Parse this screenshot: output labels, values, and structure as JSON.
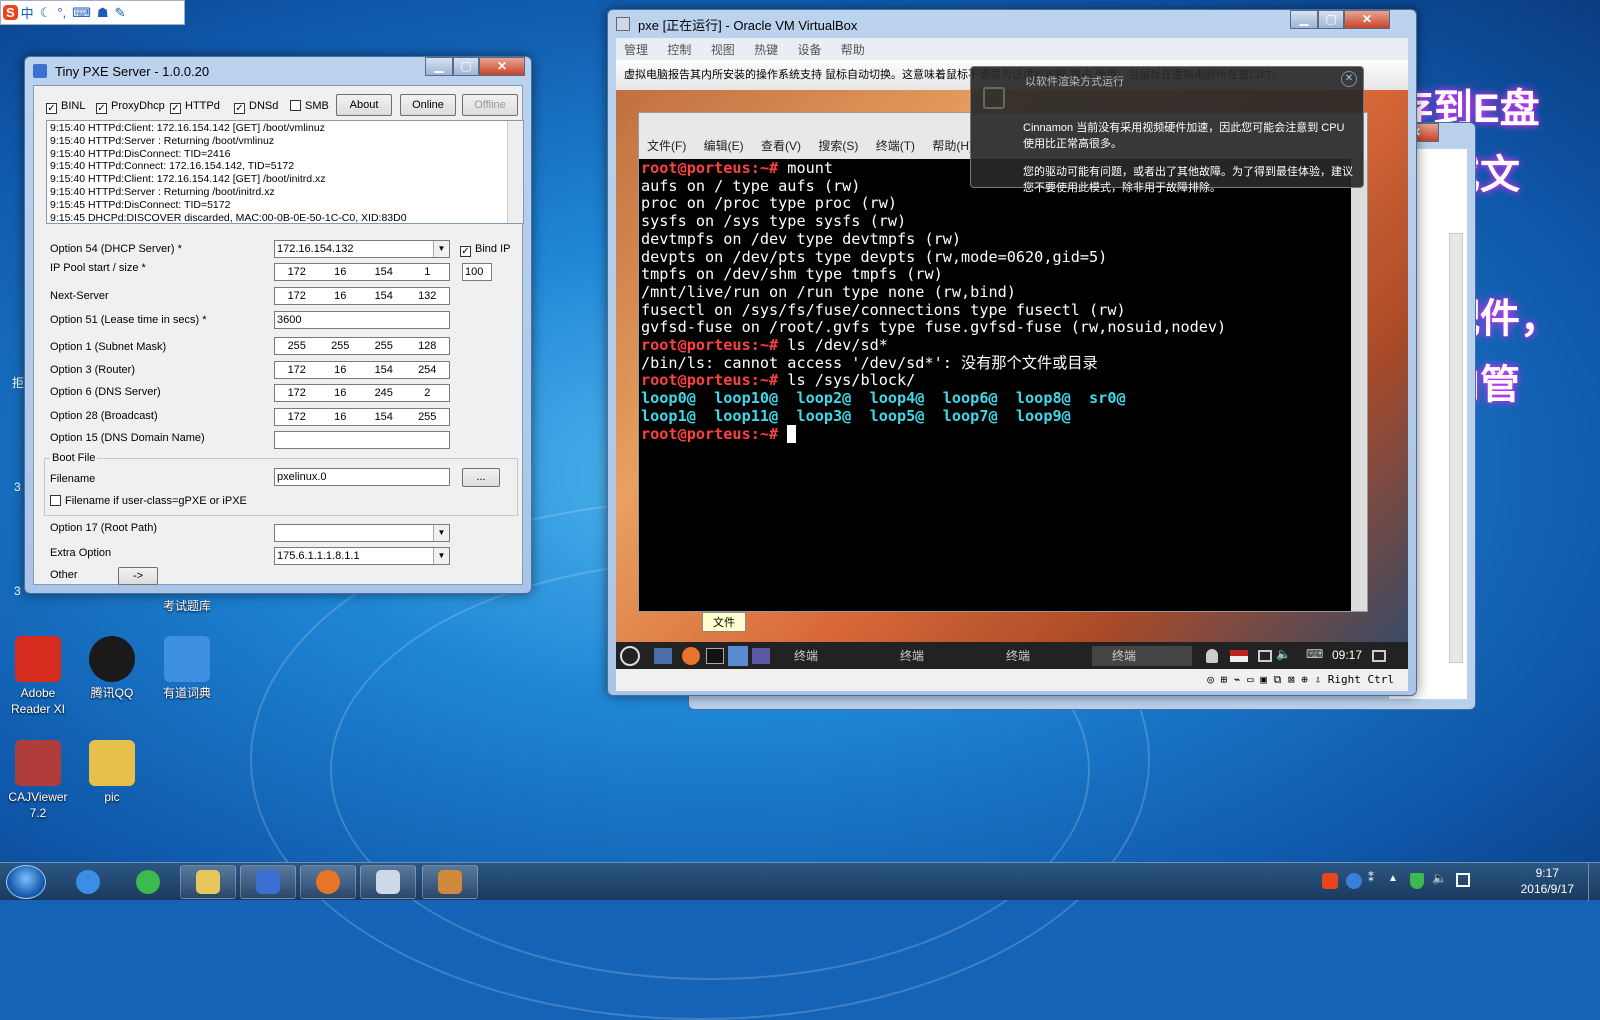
{
  "ime_bar": {
    "logo": "S",
    "lang": "中",
    "items": [
      "moon-icon",
      "punct-icon",
      "keyboard-icon",
      "skin-icon",
      "tools-icon"
    ]
  },
  "desktop": {
    "icons": [
      {
        "label": "Adobe Reader XI",
        "color": "#d62b1f"
      },
      {
        "label": "腾讯QQ",
        "color": "#1a1a1a"
      },
      {
        "label": "有道词典",
        "color": "#3d8fe0"
      },
      {
        "label": "CAJViewer 7.2",
        "color": "#b03c3c"
      },
      {
        "label": "pic",
        "color": "#e6c04a"
      }
    ],
    "bg_texts": [
      "存到E盘",
      "或文",
      "配件，",
      "向管"
    ],
    "partial_label": "考试题库",
    "edge_labels": [
      "拒",
      "3",
      "3"
    ]
  },
  "pxe": {
    "title": "Tiny PXE Server - 1.0.0.20",
    "checkboxes": [
      {
        "label": "BINL",
        "checked": true
      },
      {
        "label": "ProxyDhcp",
        "checked": true
      },
      {
        "label": "HTTPd",
        "checked": true
      },
      {
        "label": "DNSd",
        "checked": true
      },
      {
        "label": "SMB",
        "checked": false
      }
    ],
    "buttons": {
      "about": "About",
      "online": "Online",
      "offline": "Offline"
    },
    "log": [
      "9:15:40 HTTPd:Client: 172.16.154.142 [GET] /boot/vmlinuz",
      "9:15:40 HTTPd:Server : Returning /boot/vmlinuz",
      "9:15:40 HTTPd:DisConnect: TID=2416",
      "9:15:40 HTTPd:Connect: 172.16.154.142, TID=5172",
      "9:15:40 HTTPd:Client: 172.16.154.142 [GET] /boot/initrd.xz",
      "9:15:40 HTTPd:Server : Returning /boot/initrd.xz",
      "9:15:45 HTTPd:DisConnect: TID=5172",
      "9:15:45 DHCPd:DISCOVER discarded, MAC:00-0B-0E-50-1C-C0, XID:83D0"
    ],
    "labels": {
      "opt54": "Option 54 (DHCP Server) *",
      "pool": "IP Pool start / size *",
      "next": "Next-Server",
      "opt51": "Option 51 (Lease time in secs) *",
      "opt1": "Option 1  (Subnet Mask)",
      "opt3": "Option 3  (Router)",
      "opt6": "Option 6  (DNS Server)",
      "opt28": "Option 28 (Broadcast)",
      "opt15": "Option 15 (DNS Domain Name)",
      "bootfile": "Boot File",
      "filename": "Filename",
      "filename_gpxe": "Filename if user-class=gPXE or iPXE",
      "opt17": "Option 17 (Root Path)",
      "extra": "Extra Option",
      "other": "Other",
      "bindip": "Bind IP"
    },
    "values": {
      "opt54": "172.16.154.132",
      "pool": [
        "172",
        "16",
        "154",
        "1"
      ],
      "pool_size": "100",
      "next": [
        "172",
        "16",
        "154",
        "132"
      ],
      "opt51": "3600",
      "opt1": [
        "255",
        "255",
        "255",
        "128"
      ],
      "opt3": [
        "172",
        "16",
        "154",
        "254"
      ],
      "opt6": [
        "172",
        "16",
        "245",
        "2"
      ],
      "opt28": [
        "172",
        "16",
        "154",
        "255"
      ],
      "opt15": "",
      "filename": "pxelinux.0",
      "browse": "...",
      "opt17": "",
      "extra": "175.6.1.1.1.8.1.1",
      "other_btn": "->"
    }
  },
  "vbox": {
    "title": "pxe [正在运行] - Oracle VM VirtualBox",
    "menu": [
      "管理",
      "控制",
      "视图",
      "热键",
      "设备",
      "帮助"
    ],
    "notice": "虚拟电脑报告其内所安装的操作系统支持 鼠标自动切换。这意味着鼠标不需要为该虚拟电脑 独占 使用，当鼠标在虚拟电脑所在窗口时，",
    "host_key": "Right Ctrl"
  },
  "terminal": {
    "menu": [
      "文件(F)",
      "编辑(E)",
      "查看(V)",
      "搜索(S)",
      "终端(T)",
      "帮助(H)"
    ],
    "prompt": "root@porteus:~#",
    "cmd1": " mount",
    "mount_lines": [
      "aufs on / type aufs (rw)",
      "proc on /proc type proc (rw)",
      "sysfs on /sys type sysfs (rw)",
      "devtmpfs on /dev type devtmpfs (rw)",
      "devpts on /dev/pts type devpts (rw,mode=0620,gid=5)",
      "tmpfs on /dev/shm type tmpfs (rw)",
      "/mnt/live/run on /run type none (rw,bind)",
      "fusectl on /sys/fs/fuse/connections type fusectl (rw)",
      "gvfsd-fuse on /root/.gvfs type fuse.gvfsd-fuse (rw,nosuid,nodev)"
    ],
    "cmd2": " ls /dev/sd*",
    "err": "/bin/ls: cannot access '/dev/sd*': 没有那个文件或目录",
    "cmd3": " ls /sys/block/",
    "block1": "loop0@  loop10@  loop2@  loop4@  loop6@  loop8@  sr0@",
    "block2": "loop1@  loop11@  loop3@  loop5@  loop7@  loop9@"
  },
  "guest_panel": {
    "file_tip": "文件",
    "tasks": [
      "终端",
      "终端",
      "终端",
      "终端"
    ],
    "time": "09:17"
  },
  "popup": {
    "title": "以软件渲染方式运行",
    "line1": "Cinnamon 当前没有采用视频硬件加速，因此您可能会注意到 CPU",
    "line2": "使用比正常高很多。",
    "line3": "您的驱动可能有问题，或者出了其他故障。为了得到最佳体验，建议",
    "line4": "您不要使用此模式，除非用于故障排除。"
  },
  "second_window_label": "S)",
  "taskbar": {
    "apps": [
      {
        "name": "ie-icon",
        "color": "#3a8ee6"
      },
      {
        "name": "360-browser-icon",
        "color": "#3dba4e"
      },
      {
        "name": "explorer-icon",
        "color": "#e8c65a"
      },
      {
        "name": "tiny-pxe-icon",
        "color": "#3b6fd1"
      },
      {
        "name": "firefox-icon",
        "color": "#e8742a"
      },
      {
        "name": "virtualbox-icon",
        "color": "#cfd8e6"
      },
      {
        "name": "porteus-icon",
        "color": "#d08a3c"
      }
    ],
    "time": "9:17",
    "date": "2016/9/17"
  }
}
